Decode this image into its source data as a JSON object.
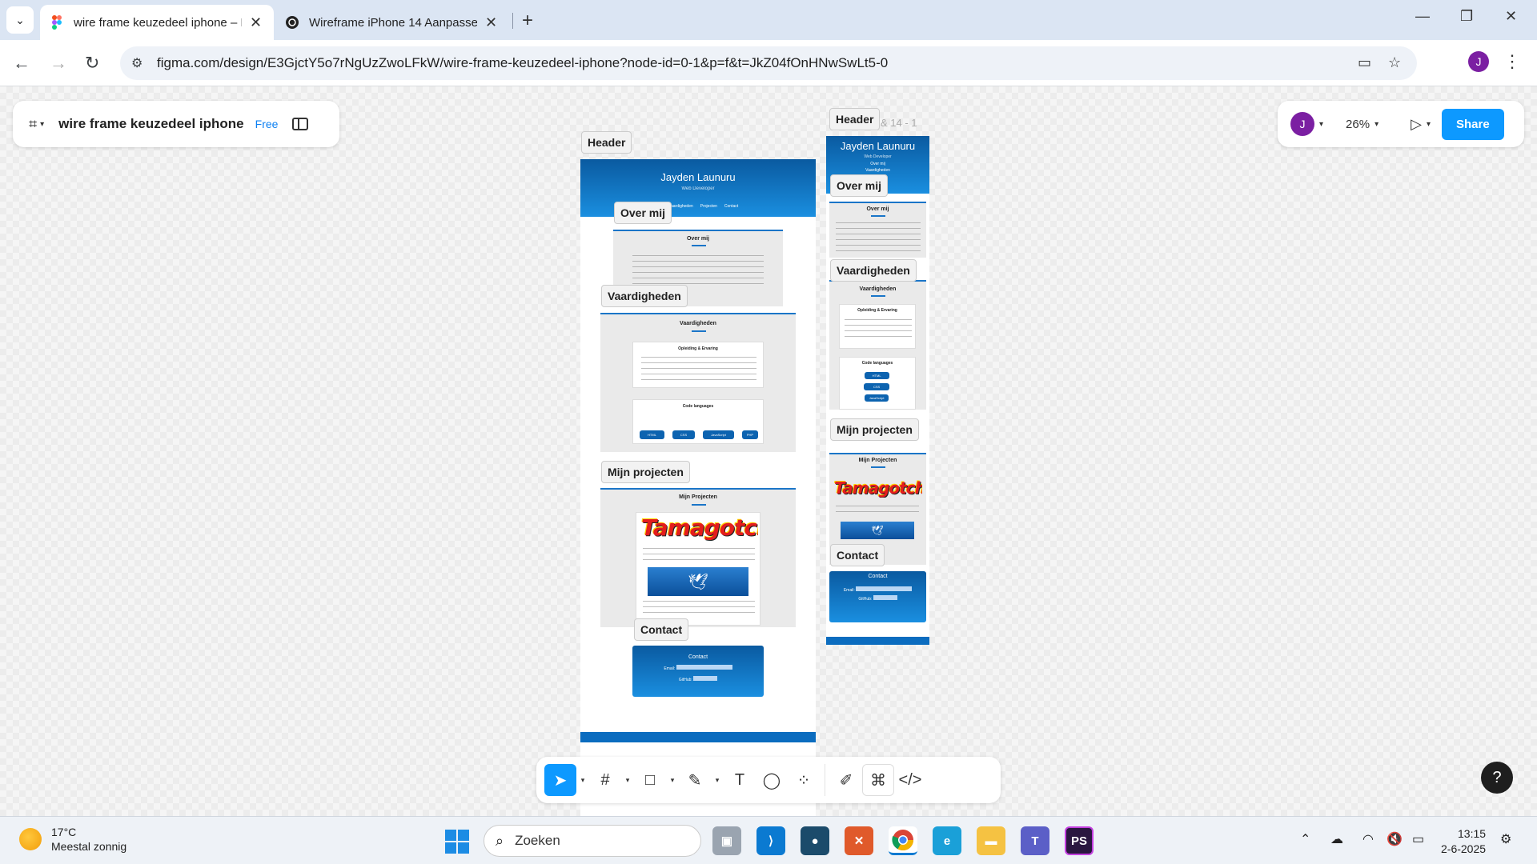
{
  "browser": {
    "tabs": [
      {
        "title": "wire frame keuzedeel iphone – Figma",
        "active": true
      },
      {
        "title": "Wireframe iPhone 14 Aanpassen",
        "active": false
      }
    ],
    "url": "figma.com/design/E3GjctY5o7rNgUzZwoLFkW/wire-frame-keuzedeel-iphone?node-id=0-1&p=f&t=JkZ04fOnHNwSwLt5-0",
    "profile_initial": "J"
  },
  "figma": {
    "file_name": "wire frame keuzedeel iphone",
    "plan": "Free",
    "user_initial": "J",
    "zoom": "26%",
    "share_label": "Share",
    "help": "?"
  },
  "frames": {
    "main": {
      "labels": {
        "header": "Header",
        "about": "Over mij",
        "skills": "Vaardigheden",
        "projects": "Mijn projecten",
        "contact": "Contact"
      },
      "name": "Jayden Launuru",
      "role": "Web Developer",
      "nav": [
        "Vaardigheden",
        "Projecten",
        "Contact"
      ],
      "about_title": "Over mij",
      "skills_title": "Vaardigheden",
      "education_title": "Opleiding & Ervaring",
      "languages_title": "Code languages",
      "languages": [
        "HTML",
        "CSS",
        "JavaScript",
        "PHP"
      ],
      "projects_title": "Mijn Projecten",
      "tamagotchi": "Tamagotchi!",
      "contact_title": "Contact",
      "contact_rows": [
        {
          "label": "Email:"
        },
        {
          "label": "GitHub:"
        }
      ]
    },
    "mobile": {
      "labels": {
        "header": "Header",
        "about": "Over mij",
        "skills": "Vaardigheden",
        "projects": "Mijn projecten",
        "contact": "Contact"
      },
      "ghost_label": "& 14 - 1",
      "name": "Jayden Launuru",
      "role": "Web Developer",
      "nav": [
        "Over mij",
        "Vaardigheden"
      ],
      "about_title": "Over mij",
      "skills_title": "Vaardigheden",
      "education_title": "Opleiding & Ervaring",
      "languages_title": "Code languages",
      "languages": [
        "HTML",
        "CSS",
        "JavaScript"
      ],
      "projects_title": "Mijn Projecten",
      "tamagotchi": "Tamagotchi!",
      "contact_title": "Contact",
      "contact_rows": [
        {
          "label": "Email:"
        },
        {
          "label": "GitHub:"
        }
      ]
    }
  },
  "taskbar": {
    "temperature": "17°C",
    "weather": "Meestal zonnig",
    "search_placeholder": "Zoeken",
    "time": "13:15",
    "date": "2-6-2025"
  },
  "colors": {
    "accent": "#0d99ff",
    "header_blue": "#0b6cbf",
    "avatar": "#7b1fa2"
  }
}
